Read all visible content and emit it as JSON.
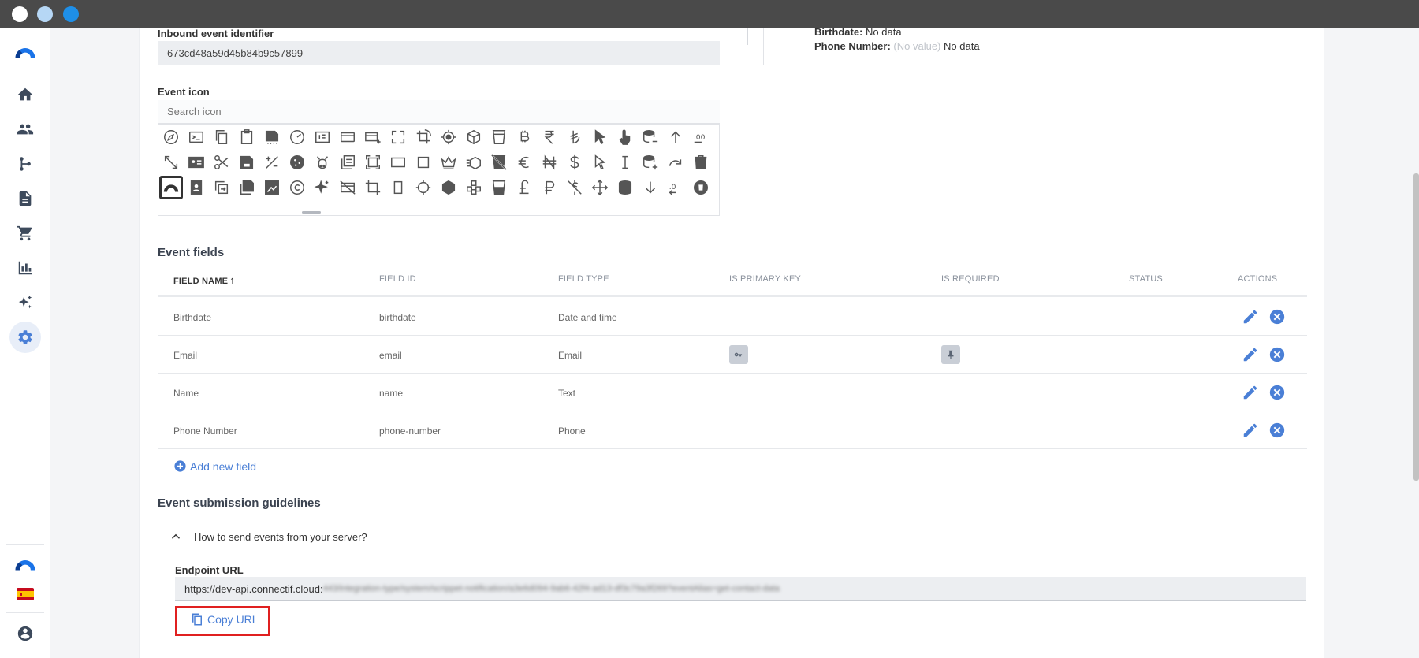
{
  "window": {
    "dots": [
      "#ffffff",
      "#b6d7f5",
      "#1e8fe8"
    ]
  },
  "sidebar": {
    "items": [
      {
        "icon": "logo-icon"
      },
      {
        "icon": "home-icon"
      },
      {
        "icon": "contacts-icon"
      },
      {
        "icon": "workflows-icon"
      },
      {
        "icon": "content-icon"
      },
      {
        "icon": "cart-icon"
      },
      {
        "icon": "reports-icon"
      },
      {
        "icon": "ai-sparkles-icon"
      },
      {
        "icon": "settings-icon"
      }
    ],
    "bottom": [
      {
        "icon": "logo-icon"
      },
      {
        "icon": "spain-flag-icon"
      },
      {
        "icon": "account-icon"
      }
    ]
  },
  "form": {
    "inbound_label": "Inbound event identifier",
    "inbound_value": "673cd48a59d45b84b9c57899",
    "icon_label": "Event icon",
    "icon_search_placeholder": "Search icon"
  },
  "preview": {
    "birthdate_label": "Birthdate:",
    "birthdate_value": "No data",
    "phone_label": "Phone Number:",
    "phone_placeholder": "(No value)",
    "phone_value": "No data"
  },
  "event_fields": {
    "title": "Event fields",
    "columns": [
      "FIELD NAME",
      "FIELD ID",
      "FIELD TYPE",
      "IS PRIMARY KEY",
      "IS REQUIRED",
      "STATUS",
      "ACTIONS"
    ],
    "rows": [
      {
        "name": "Birthdate",
        "id": "birthdate",
        "type": "Date and time",
        "primary_key": false,
        "required": false
      },
      {
        "name": "Email",
        "id": "email",
        "type": "Email",
        "primary_key": true,
        "required": true
      },
      {
        "name": "Name",
        "id": "name",
        "type": "Text",
        "primary_key": false,
        "required": false
      },
      {
        "name": "Phone Number",
        "id": "phone-number",
        "type": "Phone",
        "primary_key": false,
        "required": false
      }
    ],
    "add_label": "Add new field"
  },
  "guidelines": {
    "title": "Event submission guidelines",
    "accordion_label": "How to send events from your server?",
    "endpoint_label": "Endpoint URL",
    "endpoint_visible": "https://dev-api.connectif.cloud:",
    "endpoint_blurred": "443/integration-type/system/scrippet-notification/a3e6d094-9ab6-42f4-ad13-df3c79a3f269?eventAlias=get-contact-data",
    "copy_label": "Copy URL"
  },
  "colors": {
    "accent": "#4a7fd6",
    "highlight": "#e02020"
  }
}
